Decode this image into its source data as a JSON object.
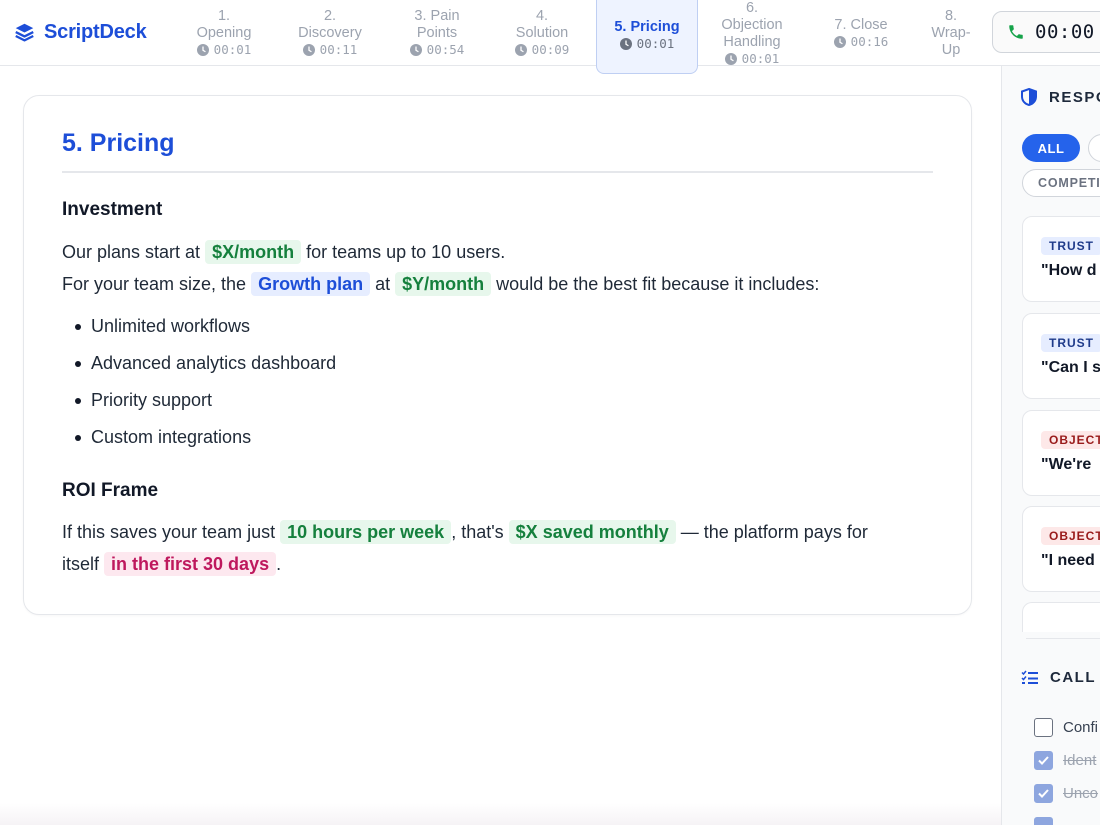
{
  "app": {
    "brand": "ScriptDeck",
    "accent_color": "#1d4ed8"
  },
  "tabs": [
    {
      "line1": "1.",
      "line2": "Opening",
      "time": "00:01",
      "active": false
    },
    {
      "line1": "2.",
      "line2": "Discovery",
      "time": "00:11",
      "active": false
    },
    {
      "line1": "3. Pain",
      "line2": "Points",
      "time": "00:54",
      "active": false
    },
    {
      "line1": "4.",
      "line2": "Solution",
      "time": "00:09",
      "active": false
    },
    {
      "line1": "5. Pricing",
      "line2": "",
      "time": "00:01",
      "active": true
    },
    {
      "line1": "6.",
      "line2": "Objection",
      "line3": "Handling",
      "time": "00:01",
      "active": false
    },
    {
      "line1": "7. Close",
      "line2": "",
      "time": "00:16",
      "active": false
    },
    {
      "line1": "8.",
      "line2": "Wrap-",
      "line3": "Up",
      "time": "",
      "active": false
    }
  ],
  "call_timer": "00:00",
  "section": {
    "title": "5. Pricing",
    "investment": {
      "heading": "Investment",
      "p1": {
        "before": "Our plans start at",
        "price": "$X/month",
        "after": "for teams up to 10 users."
      },
      "p2": {
        "before": "For your team size, the",
        "plan": "Growth plan",
        "mid": "at",
        "price": "$Y/month",
        "after": "would be the best fit because it includes:"
      },
      "features": [
        "Unlimited workflows",
        "Advanced analytics dashboard",
        "Priority support",
        "Custom integrations"
      ]
    },
    "roi": {
      "heading": "ROI Frame",
      "before": "If this saves your team just",
      "hours": "10 hours per week",
      "mid": ", that's",
      "saved": "$X saved monthly",
      "after": "— the platform pays for",
      "line2_before": "itself",
      "payback": "in the first 30 days",
      "line2_after": "."
    }
  },
  "responses_panel": {
    "heading": "RESPO",
    "filters": {
      "all": "ALL",
      "competitor": "COMPETI"
    },
    "cards": [
      {
        "tag": "TRUST",
        "tag_type": "trust",
        "text": "\"How d"
      },
      {
        "tag": "TRUST",
        "tag_type": "trust",
        "text": "\"Can I s"
      },
      {
        "tag": "OBJECT",
        "tag_type": "objection",
        "text": "\"We're"
      },
      {
        "tag": "OBJECT",
        "tag_type": "objection",
        "text": "\"I need"
      }
    ]
  },
  "checklist_panel": {
    "heading": "CALL",
    "items": [
      {
        "label": "Confi",
        "checked": false
      },
      {
        "label": "Ident",
        "checked": true
      },
      {
        "label": "Unco",
        "checked": true
      }
    ]
  }
}
